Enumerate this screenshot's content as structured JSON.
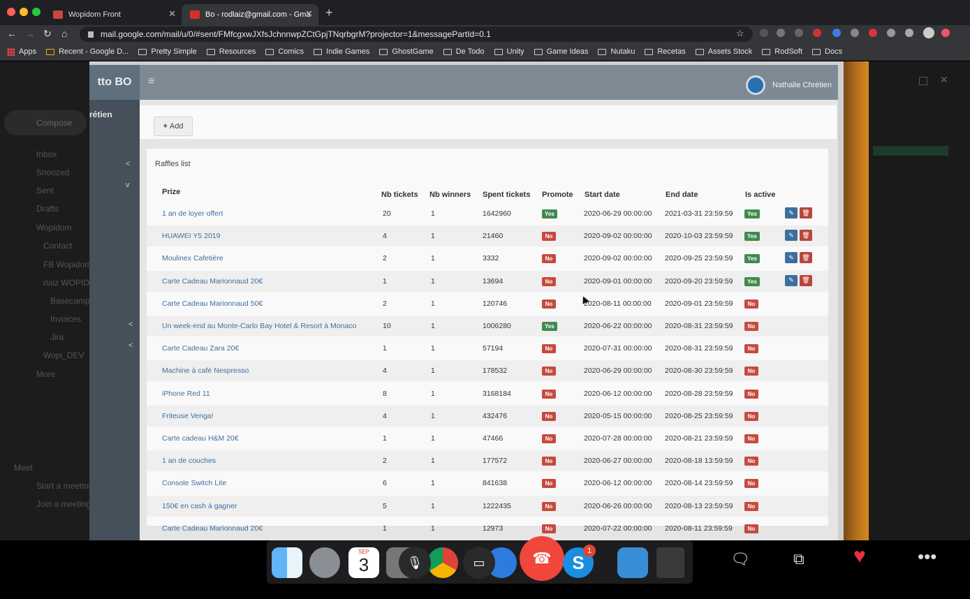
{
  "browser": {
    "tabs": [
      {
        "label": "Wopidom Front"
      },
      {
        "label": "Bo - rodlaiz@gmail.com - Gma"
      }
    ],
    "url": "mail.google.com/mail/u/0/#sent/FMfcgxwJXfsJchnnwpZCtGpjTNqrbgrM?projector=1&messagePartId=0.1",
    "bookmarks": [
      "Apps",
      "Recent - Google D...",
      "Pretty Simple",
      "Resources",
      "Comics",
      "Indie Games",
      "GhostGame",
      "De Todo",
      "Unity",
      "Game Ideas",
      "Nutaku",
      "Recetas",
      "Assets Stock",
      "RodSoft",
      "Docs"
    ]
  },
  "gmail": {
    "compose": "Compose",
    "items": [
      "Inbox",
      "Snoozed",
      "Sent",
      "Drafts",
      "Wopidom",
      "Contact",
      "FB Wopidom",
      "rlaiz WOPID",
      "Basecamp",
      "Invoices",
      "Jira",
      "Wopi_DEV",
      "More",
      "Meet",
      "Start a meeting",
      "Join a meeting"
    ]
  },
  "backoffice": {
    "brand": "tto BO",
    "user": "Nathalie Chrétien",
    "sidebar_name": "rétien",
    "add_label": "Add",
    "card_title": "Raffles list",
    "columns": [
      "Prize",
      "Nb tickets",
      "Nb winners",
      "Spent tickets",
      "Promote",
      "Start date",
      "End date",
      "Is active"
    ],
    "rows": [
      {
        "prize": "1 an de loyer offert",
        "tickets": "20",
        "winners": "1",
        "spent": "1642960",
        "promote": "Yes",
        "start": "2020-06-29 00:00:00",
        "end": "2021-03-31 23:59:59",
        "active": "Yes",
        "actions": true
      },
      {
        "prize": "HUAWEI Y5 2019",
        "tickets": "4",
        "winners": "1",
        "spent": "21460",
        "promote": "No",
        "start": "2020-09-02 00:00:00",
        "end": "2020-10-03 23:59:59",
        "active": "Yes",
        "actions": true
      },
      {
        "prize": "Moulinex Cafetière",
        "tickets": "2",
        "winners": "1",
        "spent": "3332",
        "promote": "No",
        "start": "2020-09-02 00:00:00",
        "end": "2020-09-25 23:59:59",
        "active": "Yes",
        "actions": true
      },
      {
        "prize": "Carte Cadeau Marionnaud 20€",
        "tickets": "1",
        "winners": "1",
        "spent": "13694",
        "promote": "No",
        "start": "2020-09-01 00:00:00",
        "end": "2020-09-20 23:59:59",
        "active": "Yes",
        "actions": true
      },
      {
        "prize": "Carte Cadeau Marionnaud 50€",
        "tickets": "2",
        "winners": "1",
        "spent": "120746",
        "promote": "No",
        "start": "2020-08-11 00:00:00",
        "end": "2020-09-01 23:59:59",
        "active": "No",
        "actions": false
      },
      {
        "prize": "Un week-end au Monte-Carlo Bay Hotel & Resort à Monaco",
        "tickets": "10",
        "winners": "1",
        "spent": "1006280",
        "promote": "Yes",
        "start": "2020-06-22 00:00:00",
        "end": "2020-08-31 23:59:59",
        "active": "No",
        "actions": false
      },
      {
        "prize": "Carte Cadeau Zara 20€",
        "tickets": "1",
        "winners": "1",
        "spent": "57194",
        "promote": "No",
        "start": "2020-07-31 00:00:00",
        "end": "2020-08-31 23:59:59",
        "active": "No",
        "actions": false
      },
      {
        "prize": "Machine à café Nespresso",
        "tickets": "4",
        "winners": "1",
        "spent": "178532",
        "promote": "No",
        "start": "2020-06-29 00:00:00",
        "end": "2020-08-30 23:59:59",
        "active": "No",
        "actions": false
      },
      {
        "prize": "iPhone Red 11",
        "tickets": "8",
        "winners": "1",
        "spent": "3168184",
        "promote": "No",
        "start": "2020-06-12 00:00:00",
        "end": "2020-08-28 23:59:59",
        "active": "No",
        "actions": false
      },
      {
        "prize": "Friteuse Venga!",
        "tickets": "4",
        "winners": "1",
        "spent": "432476",
        "promote": "No",
        "start": "2020-05-15 00:00:00",
        "end": "2020-08-25 23:59:59",
        "active": "No",
        "actions": false
      },
      {
        "prize": "Carte cadeau H&M 20€",
        "tickets": "1",
        "winners": "1",
        "spent": "47466",
        "promote": "No",
        "start": "2020-07-28 00:00:00",
        "end": "2020-08-21 23:59:59",
        "active": "No",
        "actions": false
      },
      {
        "prize": "1 an de couches",
        "tickets": "2",
        "winners": "1",
        "spent": "177572",
        "promote": "No",
        "start": "2020-06-27 00:00:00",
        "end": "2020-08-18 13:59:59",
        "active": "No",
        "actions": false
      },
      {
        "prize": "Console Switch Lite",
        "tickets": "6",
        "winners": "1",
        "spent": "841638",
        "promote": "No",
        "start": "2020-06-12 00:00:00",
        "end": "2020-08-14 23:59:59",
        "active": "No",
        "actions": false
      },
      {
        "prize": "150€ en cash à gagner",
        "tickets": "5",
        "winners": "1",
        "spent": "1222435",
        "promote": "No",
        "start": "2020-06-26 00:00:00",
        "end": "2020-08-13 23:59:59",
        "active": "No",
        "actions": false
      },
      {
        "prize": "Carte Cadeau Marionnaud 20€",
        "tickets": "1",
        "winners": "1",
        "spent": "12973",
        "promote": "No",
        "start": "2020-07-22 00:00:00",
        "end": "2020-08-11 23:59:59",
        "active": "No",
        "actions": false
      }
    ]
  },
  "dock": {
    "calendar_month": "SEP",
    "calendar_day": "3",
    "skype_badge": "1",
    "skype_letter": "S"
  },
  "colors": {
    "yes": "#3f8a4f",
    "no": "#c64a3f",
    "end_call": "#f0463b",
    "heart": "#e8313a"
  }
}
